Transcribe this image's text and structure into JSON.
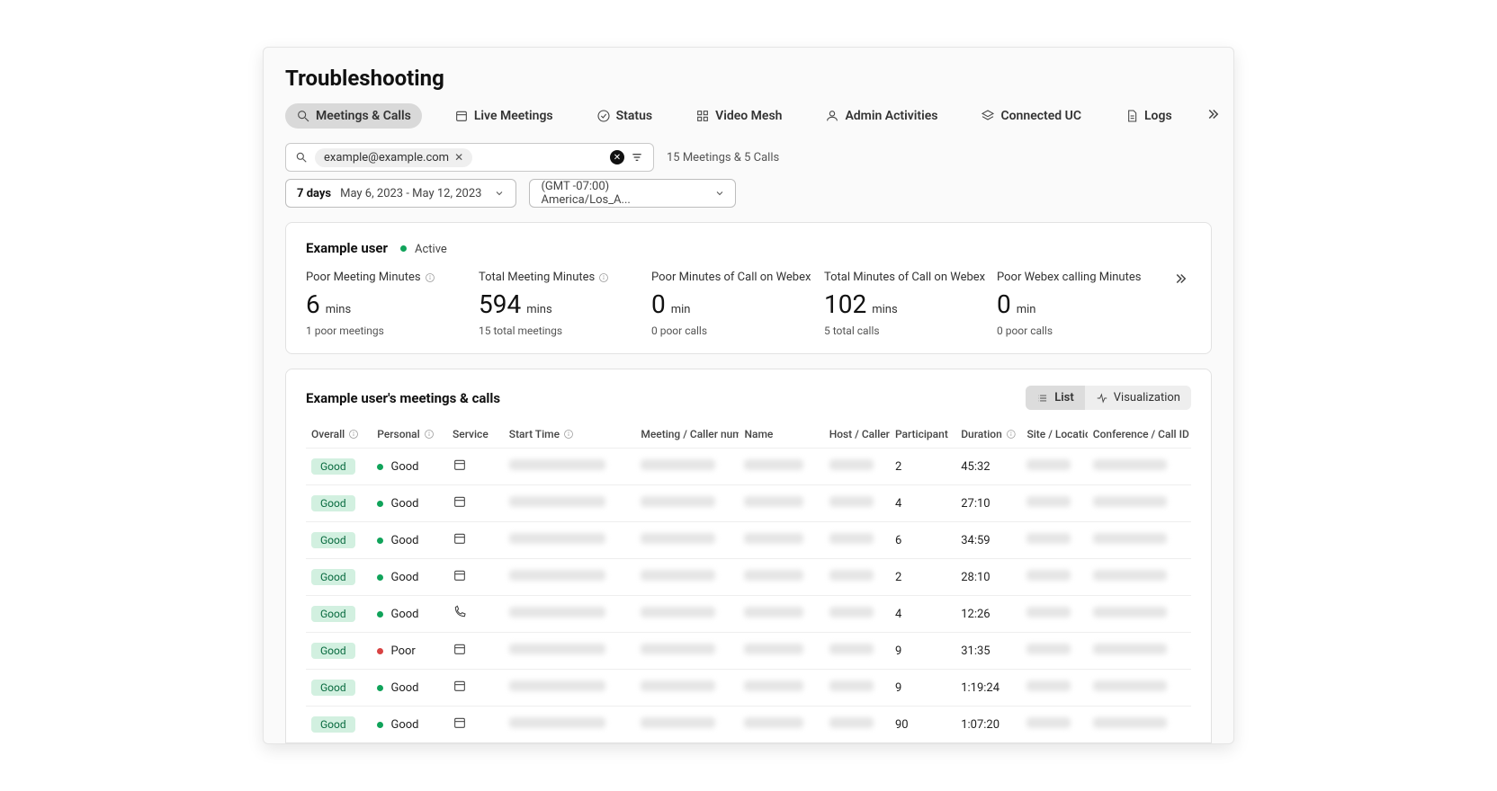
{
  "page_title": "Troubleshooting",
  "tabs": [
    {
      "label": "Meetings & Calls",
      "icon": "search-icon",
      "active": true
    },
    {
      "label": "Live Meetings",
      "icon": "calendar-icon"
    },
    {
      "label": "Status",
      "icon": "check-circle-icon"
    },
    {
      "label": "Video Mesh",
      "icon": "grid-icon"
    },
    {
      "label": "Admin Activities",
      "icon": "user-icon"
    },
    {
      "label": "Connected UC",
      "icon": "layers-icon"
    },
    {
      "label": "Logs",
      "icon": "file-icon"
    }
  ],
  "search": {
    "chip_text": "example@example.com",
    "summary": "15 Meetings & 5 Calls"
  },
  "daterange": {
    "prefix": "7 days",
    "range": "May 6, 2023 - May 12, 2023"
  },
  "timezone": {
    "label": "(GMT -07:00) America/Los_A..."
  },
  "user": {
    "name": "Example user",
    "status": "Active"
  },
  "metrics": [
    {
      "label": "Poor Meeting Minutes",
      "value": "6",
      "unit": "mins",
      "sub": "1 poor meetings"
    },
    {
      "label": "Total Meeting Minutes",
      "value": "594",
      "unit": "mins",
      "sub": "15 total meetings"
    },
    {
      "label": "Poor Minutes of Call on Webex",
      "value": "0",
      "unit": "min",
      "sub": "0 poor calls"
    },
    {
      "label": "Total Minutes of Call on Webex",
      "value": "102",
      "unit": "mins",
      "sub": "5 total calls"
    },
    {
      "label": "Poor Webex calling Minutes",
      "value": "0",
      "unit": "min",
      "sub": "0 poor calls"
    }
  ],
  "table": {
    "title": "Example user's meetings & calls",
    "view_list": "List",
    "view_viz": "Visualization",
    "columns": [
      "Overall",
      "Personal",
      "Service",
      "Start Time",
      "Meeting / Caller num",
      "Name",
      "Host / Caller",
      "Participant",
      "Duration",
      "Site / Locatio",
      "Conference / Call ID"
    ],
    "rows": [
      {
        "overall": "Good",
        "personal": "Good",
        "p_status": "good",
        "service": "meeting",
        "participants": "2",
        "duration": "45:32"
      },
      {
        "overall": "Good",
        "personal": "Good",
        "p_status": "good",
        "service": "meeting",
        "participants": "4",
        "duration": "27:10"
      },
      {
        "overall": "Good",
        "personal": "Good",
        "p_status": "good",
        "service": "meeting",
        "participants": "6",
        "duration": "34:59"
      },
      {
        "overall": "Good",
        "personal": "Good",
        "p_status": "good",
        "service": "meeting",
        "participants": "2",
        "duration": "28:10"
      },
      {
        "overall": "Good",
        "personal": "Good",
        "p_status": "good",
        "service": "call",
        "participants": "4",
        "duration": "12:26"
      },
      {
        "overall": "Good",
        "personal": "Poor",
        "p_status": "poor",
        "service": "meeting",
        "participants": "9",
        "duration": "31:35"
      },
      {
        "overall": "Good",
        "personal": "Good",
        "p_status": "good",
        "service": "meeting",
        "participants": "9",
        "duration": "1:19:24"
      },
      {
        "overall": "Good",
        "personal": "Good",
        "p_status": "good",
        "service": "meeting",
        "participants": "90",
        "duration": "1:07:20"
      }
    ]
  }
}
